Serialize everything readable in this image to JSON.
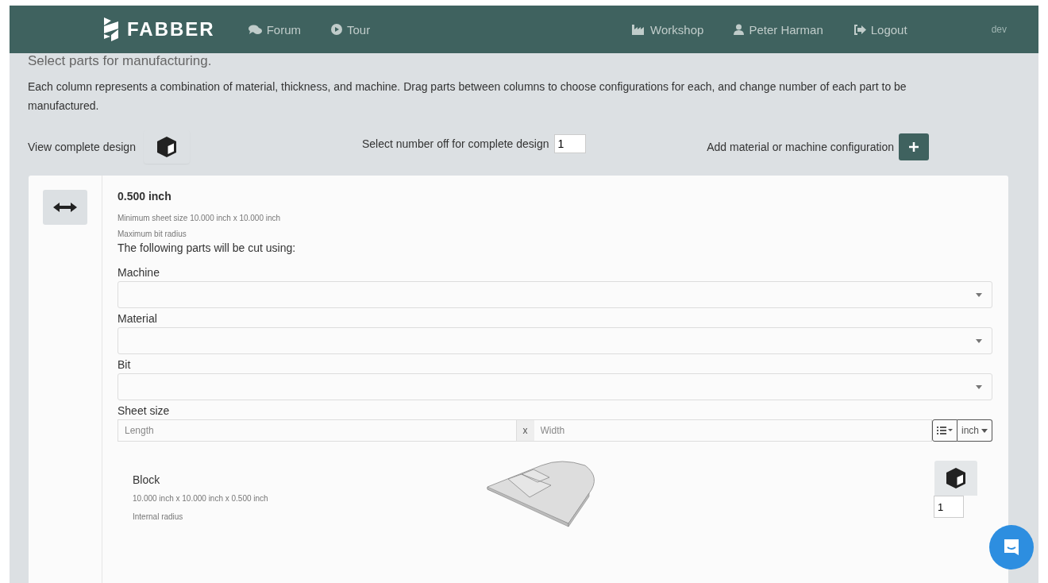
{
  "header": {
    "brand": "FABBER",
    "nav": [
      {
        "label": "Forum"
      },
      {
        "label": "Tour"
      }
    ],
    "right_nav": [
      {
        "label": "Workshop"
      },
      {
        "label": "Peter Harman"
      },
      {
        "label": "Logout"
      }
    ],
    "env": "dev"
  },
  "page": {
    "heading": "Select parts for manufacturing.",
    "description": "Each column represents a combination of material, thickness, and machine. Drag parts between columns to choose configurations for each, and change number of each part to be manufactured.",
    "view_design_label": "View complete design",
    "number_off_label": "Select number off for complete design",
    "number_off_value": "1",
    "add_config_label": "Add material or machine configuration"
  },
  "column": {
    "thickness": "0.500 inch",
    "min_sheet": "Minimum sheet size 10.000 inch x 10.000 inch",
    "max_bit": "Maximum bit radius",
    "intro": "The following parts will be cut using:",
    "selects": [
      {
        "label": "Machine"
      },
      {
        "label": "Material"
      },
      {
        "label": "Bit"
      }
    ],
    "sheet_size": {
      "label": "Sheet size",
      "length_placeholder": "Length",
      "separator": "x",
      "width_placeholder": "Width",
      "unit": "inch"
    },
    "parts": [
      {
        "name": "Block",
        "dimensions": "10.000 inch x 10.000 inch x 0.500 inch",
        "note": "Internal radius",
        "quantity": "1"
      }
    ]
  }
}
